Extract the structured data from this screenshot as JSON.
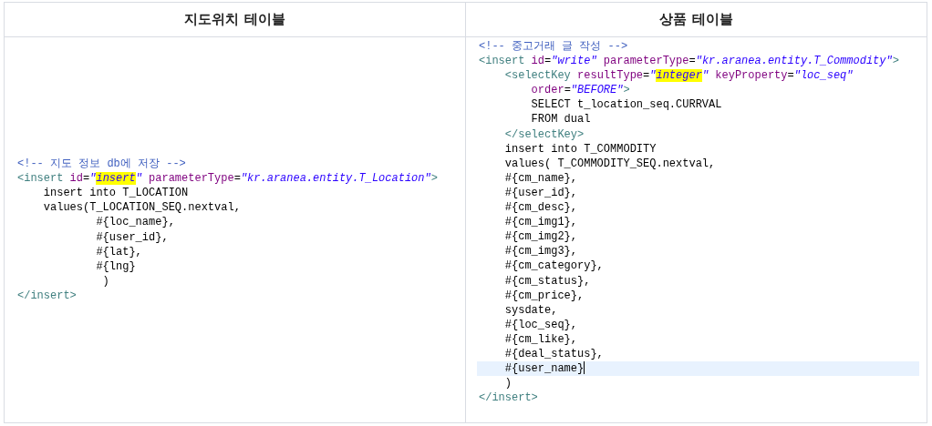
{
  "table": {
    "columns": [
      {
        "heading": "지도위치 테이블",
        "lines": [
          {
            "current": false,
            "tokens": [
              {
                "kind": "comment",
                "text": "<!-- 지도 정보 db에 저장 -->"
              }
            ]
          },
          {
            "current": false,
            "tokens": [
              {
                "kind": "tag",
                "text": "<insert"
              },
              {
                "kind": "attr",
                "text": " id"
              },
              {
                "kind": "text",
                "text": "="
              },
              {
                "kind": "value",
                "text": "\""
              },
              {
                "kind": "marked",
                "text": "insert"
              },
              {
                "kind": "value",
                "text": "\""
              },
              {
                "kind": "attr",
                "text": " parameterType"
              },
              {
                "kind": "text",
                "text": "="
              },
              {
                "kind": "value",
                "text": "\"kr.aranea.entity.T_Location\""
              },
              {
                "kind": "tag",
                "text": ">"
              }
            ]
          },
          {
            "current": false,
            "tokens": [
              {
                "kind": "text",
                "text": "    insert into T_LOCATION"
              }
            ]
          },
          {
            "current": false,
            "tokens": [
              {
                "kind": "text",
                "text": "    values(T_LOCATION_SEQ.nextval,"
              }
            ]
          },
          {
            "current": false,
            "tokens": [
              {
                "kind": "text",
                "text": "            #{loc_name},"
              }
            ]
          },
          {
            "current": false,
            "tokens": [
              {
                "kind": "text",
                "text": "            #{user_id},"
              }
            ]
          },
          {
            "current": false,
            "tokens": [
              {
                "kind": "text",
                "text": "            #{lat},"
              }
            ]
          },
          {
            "current": false,
            "tokens": [
              {
                "kind": "text",
                "text": "            #{lng}"
              }
            ]
          },
          {
            "current": false,
            "tokens": [
              {
                "kind": "text",
                "text": "             )"
              }
            ]
          },
          {
            "current": false,
            "tokens": [
              {
                "kind": "tag",
                "text": "</insert>"
              }
            ]
          }
        ]
      },
      {
        "heading": "상품 테이블",
        "lines": [
          {
            "current": false,
            "tokens": [
              {
                "kind": "comment",
                "text": "<!-- 중고거래 글 작성 -->"
              }
            ]
          },
          {
            "current": false,
            "tokens": [
              {
                "kind": "tag",
                "text": "<insert"
              },
              {
                "kind": "attr",
                "text": " id"
              },
              {
                "kind": "text",
                "text": "="
              },
              {
                "kind": "value",
                "text": "\"write\""
              },
              {
                "kind": "attr",
                "text": " parameterType"
              },
              {
                "kind": "text",
                "text": "="
              },
              {
                "kind": "value",
                "text": "\"kr.aranea.entity.T_Commodity\""
              },
              {
                "kind": "tag",
                "text": ">"
              }
            ]
          },
          {
            "current": false,
            "tokens": [
              {
                "kind": "tag",
                "text": "    <selectKey"
              },
              {
                "kind": "attr",
                "text": " resultType"
              },
              {
                "kind": "text",
                "text": "="
              },
              {
                "kind": "value",
                "text": "\""
              },
              {
                "kind": "marked",
                "text": "integer"
              },
              {
                "kind": "value",
                "text": "\""
              },
              {
                "kind": "attr",
                "text": " keyProperty"
              },
              {
                "kind": "text",
                "text": "="
              },
              {
                "kind": "value",
                "text": "\"loc_seq\""
              }
            ]
          },
          {
            "current": false,
            "tokens": [
              {
                "kind": "attr",
                "text": "        order"
              },
              {
                "kind": "text",
                "text": "="
              },
              {
                "kind": "value",
                "text": "\"BEFORE\""
              },
              {
                "kind": "tag",
                "text": ">"
              }
            ]
          },
          {
            "current": false,
            "tokens": [
              {
                "kind": "text",
                "text": "        SELECT t_location_seq.CURRVAL"
              }
            ]
          },
          {
            "current": false,
            "tokens": [
              {
                "kind": "text",
                "text": "        FROM dual"
              }
            ]
          },
          {
            "current": false,
            "tokens": [
              {
                "kind": "tag",
                "text": "    </selectKey>"
              }
            ]
          },
          {
            "current": false,
            "tokens": [
              {
                "kind": "text",
                "text": "    insert into T_COMMODITY"
              }
            ]
          },
          {
            "current": false,
            "tokens": [
              {
                "kind": "text",
                "text": "    values( T_COMMODITY_SEQ.nextval,"
              }
            ]
          },
          {
            "current": false,
            "tokens": [
              {
                "kind": "text",
                "text": "    #{cm_name},"
              }
            ]
          },
          {
            "current": false,
            "tokens": [
              {
                "kind": "text",
                "text": "    #{user_id},"
              }
            ]
          },
          {
            "current": false,
            "tokens": [
              {
                "kind": "text",
                "text": "    #{cm_desc},"
              }
            ]
          },
          {
            "current": false,
            "tokens": [
              {
                "kind": "text",
                "text": "    #{cm_img1},"
              }
            ]
          },
          {
            "current": false,
            "tokens": [
              {
                "kind": "text",
                "text": "    #{cm_img2},"
              }
            ]
          },
          {
            "current": false,
            "tokens": [
              {
                "kind": "text",
                "text": "    #{cm_img3},"
              }
            ]
          },
          {
            "current": false,
            "tokens": [
              {
                "kind": "text",
                "text": "    #{cm_category},"
              }
            ]
          },
          {
            "current": false,
            "tokens": [
              {
                "kind": "text",
                "text": "    #{cm_status},"
              }
            ]
          },
          {
            "current": false,
            "tokens": [
              {
                "kind": "text",
                "text": "    #{cm_price},"
              }
            ]
          },
          {
            "current": false,
            "tokens": [
              {
                "kind": "text",
                "text": "    sysdate,"
              }
            ]
          },
          {
            "current": false,
            "tokens": [
              {
                "kind": "text",
                "text": "    #{loc_seq},"
              }
            ]
          },
          {
            "current": false,
            "tokens": [
              {
                "kind": "text",
                "text": "    #{cm_like},"
              }
            ]
          },
          {
            "current": false,
            "tokens": [
              {
                "kind": "text",
                "text": "    #{deal_status},"
              }
            ]
          },
          {
            "current": true,
            "tokens": [
              {
                "kind": "text",
                "text": "    #{user_name}"
              }
            ]
          },
          {
            "current": false,
            "tokens": [
              {
                "kind": "text",
                "text": "    )"
              }
            ]
          },
          {
            "current": false,
            "tokens": [
              {
                "kind": "tag",
                "text": "</insert>"
              }
            ]
          }
        ]
      }
    ]
  }
}
